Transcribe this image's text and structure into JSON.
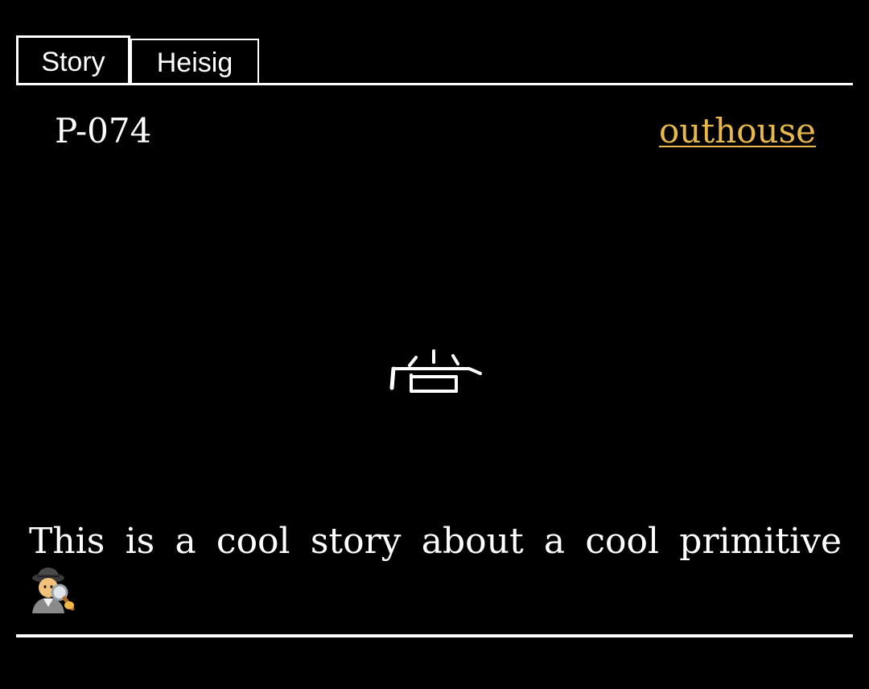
{
  "tabs": [
    {
      "label": "Story"
    },
    {
      "label": "Heisig"
    }
  ],
  "card": {
    "id": "P-074",
    "keyword": "outhouse",
    "keyword_color": "#e8b84a",
    "story_text": "This is a cool story about a cool primitive",
    "story_icon": "detective-icon"
  },
  "colors": {
    "background": "#000000",
    "foreground": "#ffffff",
    "accent": "#e8b84a"
  }
}
